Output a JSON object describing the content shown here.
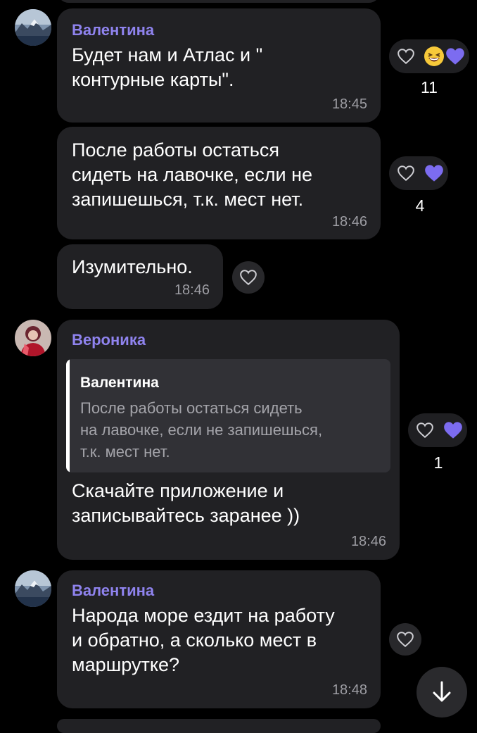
{
  "messages": [
    {
      "sender": "Валентина",
      "text": "Будет нам и Атлас и \"\nконтурные карты\".",
      "time": "18:45",
      "reaction_count": "11"
    },
    {
      "text": "После работы остаться\nсидеть на лавочке, если не\nзапишешься, т.к. мест нет.",
      "time": "18:46",
      "reaction_count": "4"
    },
    {
      "text": "Изумительно.",
      "time": "18:46"
    },
    {
      "sender": "Вероника",
      "reply_sender": "Валентина",
      "reply_text": "После работы остаться сидеть\nна лавочке, если не запишешься,\nт.к. мест нет.",
      "text": "Скачайте приложение и\nзаписывайтесь заранее ))",
      "time": "18:46",
      "reaction_count": "1"
    },
    {
      "sender": "Валентина",
      "text": "Народа море ездит на работу\nи обратно, а сколько мест в\nмаршрутке?",
      "time": "18:48"
    }
  ],
  "colors": {
    "background": "#000000",
    "bubble": "#212124",
    "sender_name": "#8f83ee",
    "heart_reaction": "#7c6cf0",
    "timestamp": "#9d9da3"
  },
  "icons": [
    "heart-outline-icon",
    "laughing-emoji-icon",
    "purple-heart-icon",
    "arrow-down-icon"
  ]
}
